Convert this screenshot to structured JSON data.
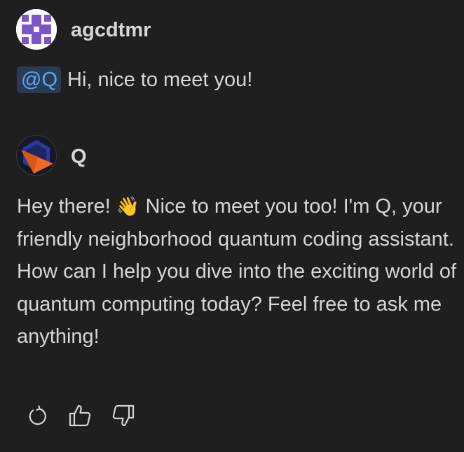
{
  "user": {
    "name": "agcdtmr",
    "avatar_icon": "purple-cross-identicon",
    "message": {
      "mention": "@Q",
      "text": "Hi, nice to meet you!"
    }
  },
  "bot": {
    "name": "Q",
    "avatar_icon": "orange-blue-hexagon-logo",
    "message": {
      "part1": "Hey there! ",
      "emoji": "👋",
      "part2": " Nice to meet you too! I'm Q, your friendly neighborhood quantum coding assistant. How can I help you dive into the exciting world of quantum computing today? Feel free to ask me anything!"
    }
  },
  "actions": [
    {
      "icon": "refresh-icon"
    },
    {
      "icon": "thumbs-up-icon"
    },
    {
      "icon": "thumbs-down-icon"
    }
  ],
  "colors": {
    "background": "#1f1f1f",
    "text": "#d6d6d6",
    "mention_bg": "#2a3b53",
    "mention_text": "#5aa6f0",
    "user_avatar_purple": "#7c55c6",
    "bot_avatar_orange": "#f06b25",
    "bot_avatar_blue": "#2b3a9a"
  }
}
